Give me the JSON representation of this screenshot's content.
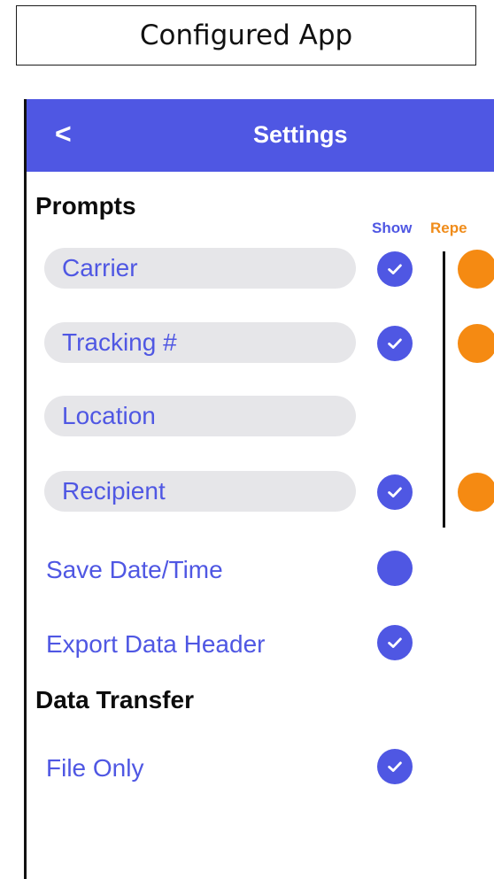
{
  "caption": "Configured App",
  "appbar": {
    "back_label": "<",
    "title": "Settings"
  },
  "prompts": {
    "heading": "Prompts",
    "col_show": "Show",
    "col_repeat": "Repe",
    "items": [
      {
        "label": "Carrier",
        "show": true,
        "repeat": true
      },
      {
        "label": "Tracking #",
        "show": true,
        "repeat": true
      },
      {
        "label": "Location",
        "show": false,
        "repeat": false
      },
      {
        "label": "Recipient",
        "show": true,
        "repeat": true
      }
    ]
  },
  "options": [
    {
      "label": "Save Date/Time",
      "checked": false
    },
    {
      "label": "Export Data Header",
      "checked": true
    }
  ],
  "data_transfer": {
    "heading": "Data Transfer",
    "items": [
      {
        "label": "File Only",
        "checked": true
      }
    ]
  },
  "colors": {
    "accent": "#4f57e3",
    "repeat": "#f58a12",
    "pill_bg": "#e6e6e9"
  }
}
